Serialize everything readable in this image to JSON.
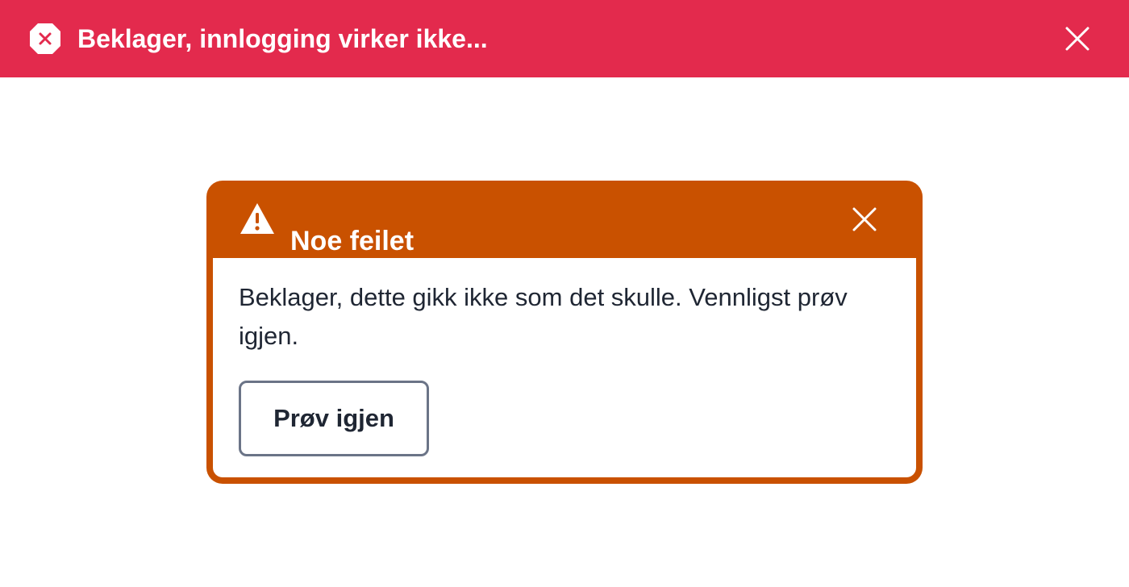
{
  "banner": {
    "title": "Beklager, innlogging virker ikke...",
    "icon": "error-octagon-icon",
    "close_icon": "close-icon",
    "background_color": "#e32a4d"
  },
  "dialog": {
    "title": "Noe feilet",
    "icon": "warning-triangle-icon",
    "close_icon": "close-icon",
    "message": "Beklager, dette gikk ikke som det skulle. Vennligst prøv igjen.",
    "retry_label": "Prøv igjen",
    "accent_color": "#c95100"
  }
}
